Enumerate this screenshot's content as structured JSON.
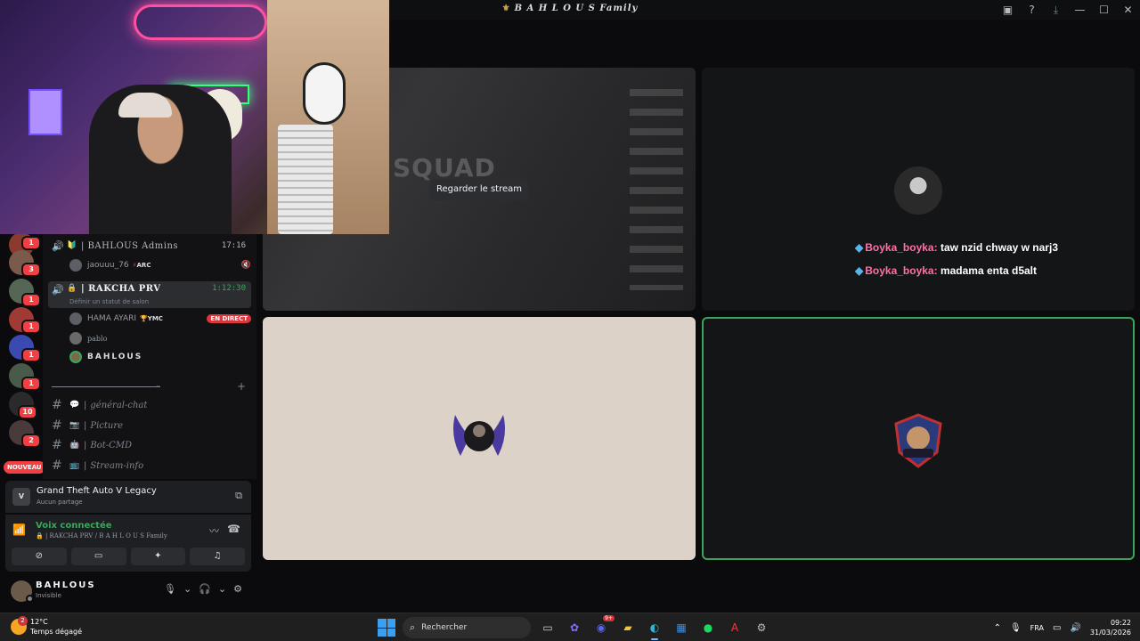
{
  "window": {
    "title": "B A H L O U S Family",
    "controls": [
      "cast-icon",
      "help-icon",
      "download-icon",
      "minimize-icon",
      "maximize-icon",
      "close-icon"
    ]
  },
  "guild_badges": [
    "1",
    "3",
    "1",
    "1",
    "1",
    "1",
    "10",
    "2"
  ],
  "guild_new_label": "NOUVEAU",
  "voice_channels": [
    {
      "name": "| BAHLOUS Admins",
      "time": "17:16",
      "members": [
        {
          "name": "jaouuu_76",
          "tag": "ARC"
        }
      ]
    },
    {
      "name": "| RAKCHA PRV",
      "time": "1:12:30",
      "subtitle": "Définir un statut de salon",
      "members": [
        {
          "name": "HAMA AYARI",
          "tag": "YMC",
          "live": "EN DIRECT"
        },
        {
          "name": "pablo"
        },
        {
          "name": "BAHLOUS"
        }
      ]
    }
  ],
  "text_channels": [
    {
      "name": "général-chat",
      "emoji": "💬"
    },
    {
      "name": "Picture",
      "emoji": "📷"
    },
    {
      "name": "Bot-CMD",
      "emoji": "🤖"
    },
    {
      "name": "Stream-info",
      "emoji": "📺"
    }
  ],
  "activity": {
    "title": "Grand Theft Auto V Legacy",
    "subtitle": "Aucun partage",
    "icon": "V"
  },
  "voice_status": {
    "title": "Voix connectée",
    "channel": "| RAKCHA PRV / B A H L O U S Family"
  },
  "user": {
    "name": "BAHLOUS",
    "status": "Invisible"
  },
  "stage": {
    "watch_button": "Regarder le stream",
    "stream_preview_text": "SQUAD",
    "chat": [
      {
        "user": "Boyka_boyka:",
        "text": "taw nzid chway w narj3"
      },
      {
        "user": "Boyka_boyka:",
        "text": "madama enta d5alt"
      }
    ]
  },
  "taskbar": {
    "weather_badge": "2",
    "temperature": "12°C",
    "weather": "Temps dégagé",
    "search_placeholder": "Rechercher",
    "discord_badge": "9+",
    "lang": "FRA",
    "time": "09:22",
    "date": "31/03/2026"
  },
  "colors": {
    "accent_green": "#3ba55d",
    "live_red": "#da373c",
    "chat_user": "#ff6fa8"
  }
}
